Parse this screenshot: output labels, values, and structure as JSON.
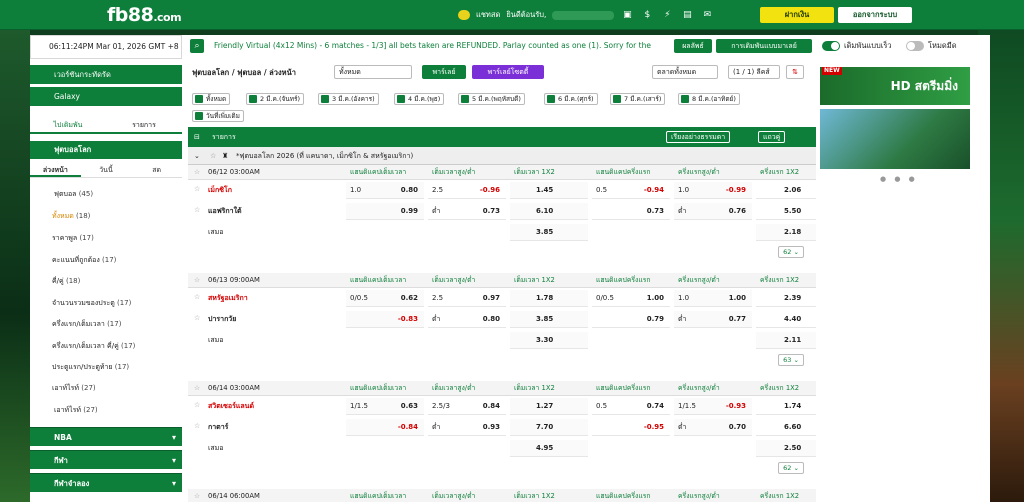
{
  "header": {
    "logo": "fb88",
    "logo_suffix": ".com",
    "chat": "แชทสด",
    "welcome": "ยินดีต้อนรับ,",
    "deposit": "ฝากเงิน",
    "logout": "ออกจากระบบ"
  },
  "top": {
    "datetime": "06:11:24PM Mar 01, 2026 GMT +8",
    "ticker": "Friendly Virtual (4x12 Mins) - 6 matches - 1/3] all bets taken are REFUNDED. Parlay counted as one (1). Sorry for the",
    "parlay_btn": "ผลลัพธ์",
    "odds_btn": "การเดิมพันแบบมาเลย์",
    "toggle1": "เดิมพันแบบเร็ว",
    "toggle2": "โหมดมืด"
  },
  "sidebar": {
    "virtual": "เวอร์ชันกระทัดรัด",
    "galaxy": "Galaxy",
    "tab1": "ไปเดิมพัน",
    "tab2": "รายการ",
    "soccer_head": "ฟุตบอลโลก",
    "sub1": "ล่วงหน้า",
    "sub2": "วันนี้",
    "sub3": "สด",
    "cats": [
      {
        "label": "ฟุตบอล",
        "count": "(45)"
      },
      {
        "label": "ทั้งหมด",
        "count": "(18)"
      },
      {
        "label": "ราคาพูล",
        "count": "(17)"
      },
      {
        "label": "คะแนนที่ถูกต้อง",
        "count": "(17)"
      },
      {
        "label": "คี่/คู่",
        "count": "(18)"
      },
      {
        "label": "จำนวนรวมของประตู",
        "count": "(17)"
      },
      {
        "label": "ครึ่งแรก/เต็มเวลา",
        "count": "(17)"
      },
      {
        "label": "ครึ่งแรก/เต็มเวลา คี่/คู่",
        "count": "(17)"
      },
      {
        "label": "ประตูแรก/ประตูท้าย",
        "count": "(17)"
      },
      {
        "label": "เอาท์ไรท์",
        "count": "(27)"
      },
      {
        "label": "เอาท์ไรท์",
        "count": "(27)"
      }
    ],
    "sports": [
      "NBA",
      "กีฬา",
      "กีฬาจำลอง"
    ]
  },
  "center": {
    "crumb": "ฟุตบอลโลก / ฟุตบอล / ล่วงหน้า",
    "filter": "ทั้งหมด",
    "parlay": "พาร์เลย์",
    "parlay2": "พาร์เลย์โซตตี้",
    "market": "ตลาดทั้งหมด",
    "page": "(1 / 1) ลีคส์",
    "chips": [
      "ทั้งหมด",
      "2 มี.ค.(จันทร์)",
      "3 มี.ค.(อังคาร)",
      "4 มี.ค.(พุธ)",
      "5 มี.ค.(พฤหัสบดี)",
      "6 มี.ค.(ศุกร์)",
      "7 มี.ค.(เสาร์)",
      "8 มี.ค.(อาทิตย์)",
      "วันที่เพิ่มเติม"
    ],
    "list_label": "รายการ",
    "sort": "เรียงอย่างธรรมดา",
    "display": "แถวคู่",
    "league": "*ฟุตบอลโลก 2026 (ที่ แคนาดา, เม็กซิโก & สหรัฐอเมริกา)",
    "cols": [
      "แฮนดิแคปเต็มเวลา",
      "เต็มเวลาสูง/ต่ำ",
      "เต็มเวลา 1X2",
      "แฮนดิแคปครึ่งแรก",
      "ครึ่งแรกสูง/ต่ำ",
      "ครึ่งแรก 1X2"
    ],
    "matches": [
      {
        "date": "06/12 03:00AM",
        "home": "เม็กซิโก",
        "away": "แอฟริกาใต้",
        "draw": "เสมอ",
        "more": "62",
        "r1": [
          "1.0",
          "0.80",
          "2.5",
          "-0.96",
          "1.45",
          "0.5",
          "-0.94",
          "1.0",
          "-0.99",
          "2.06"
        ],
        "r2": [
          "",
          "0.99",
          "ต่ำ",
          "0.73",
          "6.10",
          "",
          "0.73",
          "ต่ำ",
          "0.76",
          "5.50"
        ],
        "r3": [
          "3.85",
          "2.18"
        ]
      },
      {
        "date": "06/13 09:00AM",
        "home": "สหรัฐอเมริกา",
        "away": "ปารากวัย",
        "draw": "เสมอ",
        "more": "63",
        "r1": [
          "0/0.5",
          "0.62",
          "2.5",
          "0.97",
          "1.78",
          "0/0.5",
          "1.00",
          "1.0",
          "1.00",
          "2.39"
        ],
        "r2": [
          "",
          "-0.83",
          "ต่ำ",
          "0.80",
          "3.85",
          "",
          "0.79",
          "ต่ำ",
          "0.77",
          "4.40"
        ],
        "r3": [
          "3.30",
          "2.11"
        ]
      },
      {
        "date": "06/14 03:00AM",
        "home": "สวิตเซอร์แลนด์",
        "away": "กาตาร์",
        "draw": "เสมอ",
        "more": "62",
        "r1": [
          "1/1.5",
          "0.63",
          "2.5/3",
          "0.84",
          "1.27",
          "0.5",
          "0.74",
          "1/1.5",
          "-0.93",
          "1.74"
        ],
        "r2": [
          "",
          "-0.84",
          "ต่ำ",
          "0.93",
          "7.70",
          "",
          "-0.95",
          "ต่ำ",
          "0.70",
          "6.60"
        ],
        "r3": [
          "4.95",
          "2.50"
        ]
      },
      {
        "date": "06/14 06:00AM"
      }
    ]
  },
  "right": {
    "banner": "HD สตรีมมิ่ง",
    "new": "NEW"
  }
}
